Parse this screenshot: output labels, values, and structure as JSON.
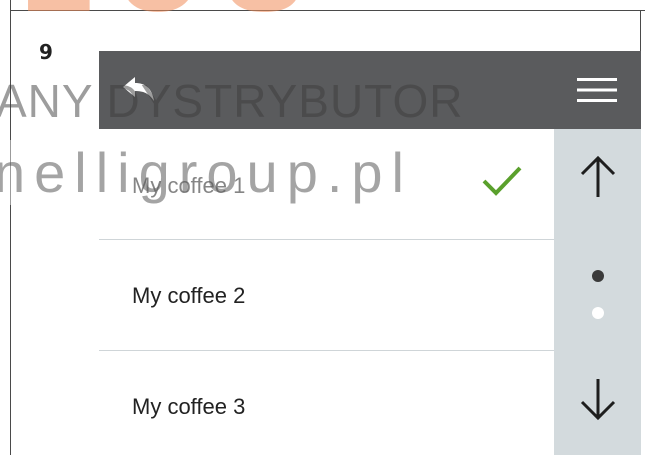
{
  "step": {
    "number": "9"
  },
  "watermark": {
    "line1": "ANY DYSTRYBUTOR",
    "line2": "nelligroup.pl",
    "logo_text": "LUS"
  },
  "header": {
    "back_icon": "back-arrow-icon",
    "menu_icon": "hamburger-menu-icon"
  },
  "list": {
    "items": [
      {
        "label": "My coffee 1",
        "selected": true
      },
      {
        "label": "My coffee 2",
        "selected": false
      },
      {
        "label": "My coffee 3",
        "selected": false
      }
    ]
  },
  "scrollbar": {
    "up_icon": "arrow-up-icon",
    "down_icon": "arrow-down-icon",
    "pages": 2,
    "current_page": 1
  },
  "colors": {
    "header_bg": "#5a5b5d",
    "scrollbar_bg": "#d3dadd",
    "check": "#5aa02c"
  }
}
